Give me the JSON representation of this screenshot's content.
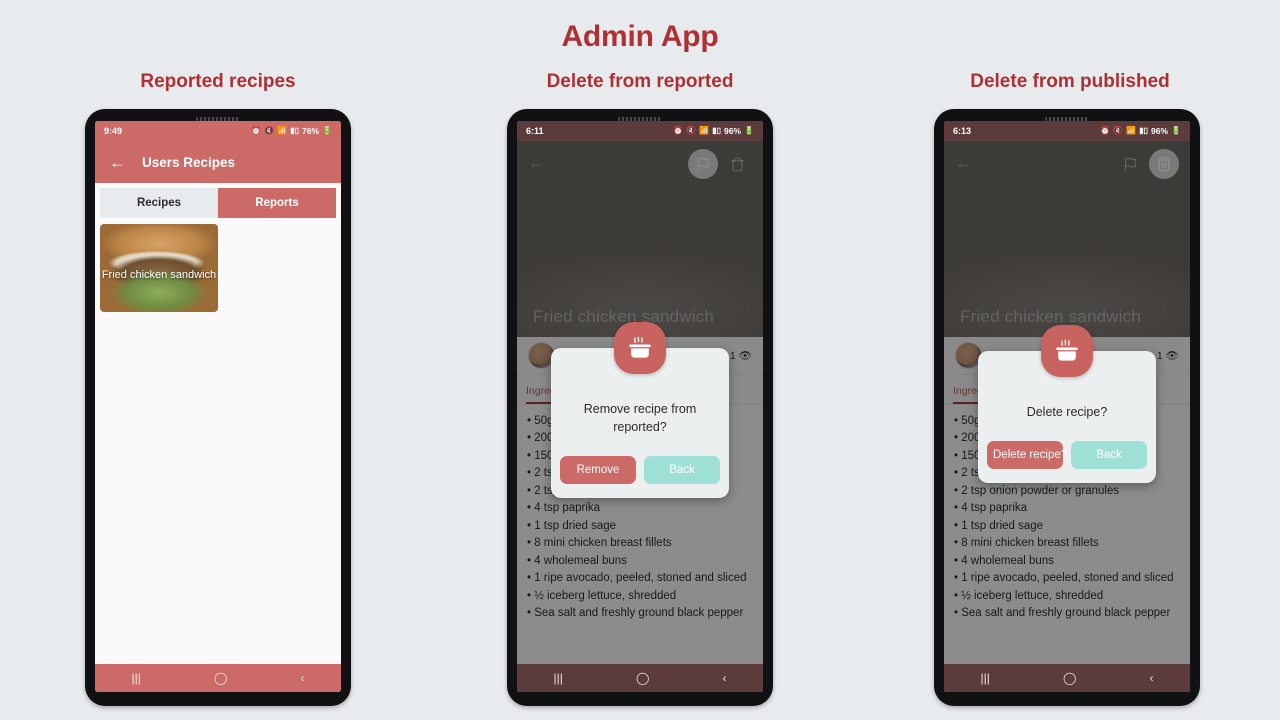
{
  "header": {
    "app_title": "Admin App",
    "accent_color": "#b02f33",
    "background_color": "#e8ebee"
  },
  "panels": [
    {
      "title": "Reported recipes"
    },
    {
      "title": "Delete from reported"
    },
    {
      "title": "Delete from published"
    }
  ],
  "theme": {
    "primary": "#cb6a67",
    "primary_dark": "#5c3b3c",
    "teal": "#9fe0d6",
    "tab_inactive_bg": "#e7ebee"
  },
  "phone1": {
    "status": {
      "time": "9:49",
      "battery": "76%",
      "icons": [
        "alarm-icon",
        "mute-icon",
        "wifi-icon",
        "signal-icon",
        "battery-icon"
      ]
    },
    "appbar": {
      "back": "←",
      "title": "Users Recipes"
    },
    "tabs": [
      {
        "label": "Recipes",
        "state": "inactive"
      },
      {
        "label": "Reports",
        "state": "active"
      }
    ],
    "recipe_card": {
      "caption": "Fried chicken sandwich"
    },
    "navbar": {
      "recents": "|||",
      "home": "◯",
      "back": "‹"
    }
  },
  "phone2": {
    "status": {
      "time": "6:11",
      "battery": "96%"
    },
    "hero": {
      "title": "Fried chicken sandwich",
      "flag_highlighted": true,
      "trash_highlighted": false
    },
    "author": {
      "views": "1"
    },
    "section_tab": "Ingredients",
    "ingredients": [
      "• 50g plain flour",
      "• 200ml buttermilk",
      "• 150g breadcrumbs",
      "• 2 tsp garlic powder",
      "• 2 tsp onion powder or granules",
      "• 4 tsp paprika",
      "• 1 tsp dried sage",
      "• 8 mini chicken breast fillets",
      "• 4 wholemeal buns",
      "• 1 ripe avocado, peeled, stoned and sliced",
      "• ½ iceberg lettuce, shredded",
      "• Sea salt and freshly ground black pepper"
    ],
    "dialog": {
      "message": "Remove recipe from reported?",
      "confirm_label": "Remove",
      "cancel_label": "Back",
      "badge_icon": "cooking-pot-icon"
    },
    "navbar": {
      "recents": "|||",
      "home": "◯",
      "back": "‹"
    }
  },
  "phone3": {
    "status": {
      "time": "6:13",
      "battery": "96%"
    },
    "hero": {
      "title": "Fried chicken sandwich",
      "flag_highlighted": false,
      "trash_highlighted": true
    },
    "author": {
      "views": "1"
    },
    "section_tab": "Ingredients",
    "ingredients": [
      "• 50g plain flour",
      "• 200ml buttermilk",
      "• 150g breadcrumbs",
      "• 2 tsp garlic powder",
      "• 2 tsp onion powder or granules",
      "• 4 tsp paprika",
      "• 1 tsp dried sage",
      "• 8 mini chicken breast fillets",
      "• 4 wholemeal buns",
      "• 1 ripe avocado, peeled, stoned and sliced",
      "• ½ iceberg lettuce, shredded",
      "• Sea salt and freshly ground black pepper"
    ],
    "dialog": {
      "message": "Delete recipe?",
      "confirm_label": "Delete recipe?",
      "cancel_label": "Back",
      "badge_icon": "cooking-pot-icon"
    },
    "navbar": {
      "recents": "|||",
      "home": "◯",
      "back": "‹"
    }
  }
}
